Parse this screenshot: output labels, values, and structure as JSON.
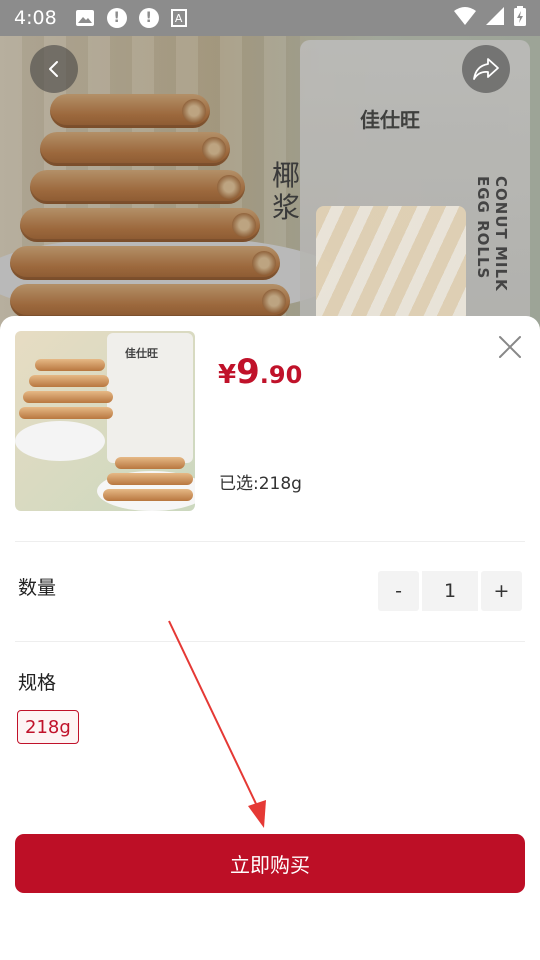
{
  "status_bar": {
    "time": "4:08",
    "left_icons": [
      "image-icon",
      "alert-icon",
      "alert-icon",
      "a-icon"
    ],
    "right_icons": [
      "wifi-icon",
      "signal-icon",
      "battery-icon"
    ]
  },
  "hero": {
    "brand_text": "佳仕旺",
    "vertical_text": "椰浆",
    "side_text": "CONUT MILK EGG ROLLS"
  },
  "product": {
    "thumb_brand": "佳仕旺",
    "price_currency": "¥",
    "price_integer": "9",
    "price_decimal": ".90",
    "selected_text": "已选:218g"
  },
  "quantity": {
    "label": "数量",
    "minus": "-",
    "value": "1",
    "plus": "+"
  },
  "spec": {
    "label": "规格",
    "options": [
      "218g"
    ],
    "selected": "218g"
  },
  "buy_button": {
    "label": "立即购买"
  },
  "colors": {
    "accent": "#bd0f26",
    "price": "#c0122a",
    "status_bar": "#8c8c8c"
  }
}
